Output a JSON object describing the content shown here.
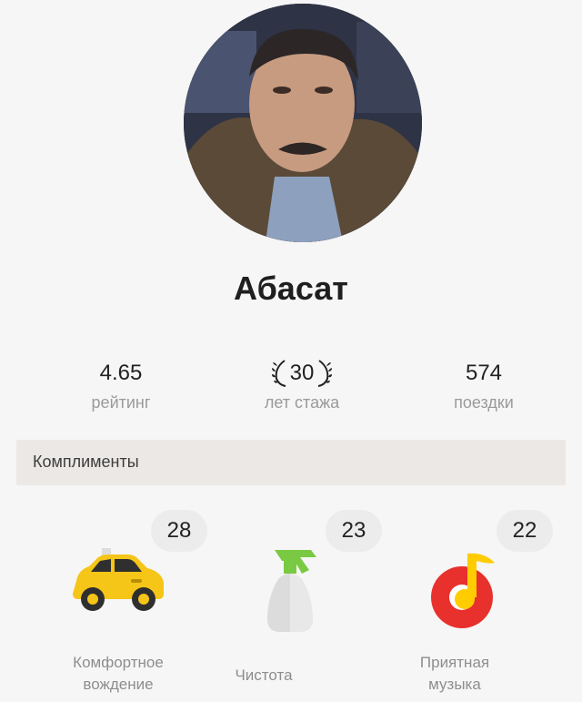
{
  "driver": {
    "name": "Абасат"
  },
  "stats": {
    "rating": {
      "value": "4.65",
      "label": "рейтинг"
    },
    "experience": {
      "value": "30",
      "label": "лет стажа"
    },
    "trips": {
      "value": "574",
      "label": "поездки"
    }
  },
  "compliments": {
    "title": "Комплименты",
    "items": [
      {
        "count": "28",
        "line1": "Комфортное",
        "line2": "вождение",
        "icon": "taxi-car-icon"
      },
      {
        "count": "23",
        "line1": "Чистота",
        "line2": "",
        "icon": "spray-bottle-icon"
      },
      {
        "count": "22",
        "line1": "Приятная",
        "line2": "музыка",
        "icon": "music-note-icon"
      }
    ]
  },
  "colors": {
    "taxi_yellow": "#f5c518",
    "spray_green": "#7ac943",
    "music_red": "#e8302d",
    "music_yellow": "#ffcc00"
  }
}
